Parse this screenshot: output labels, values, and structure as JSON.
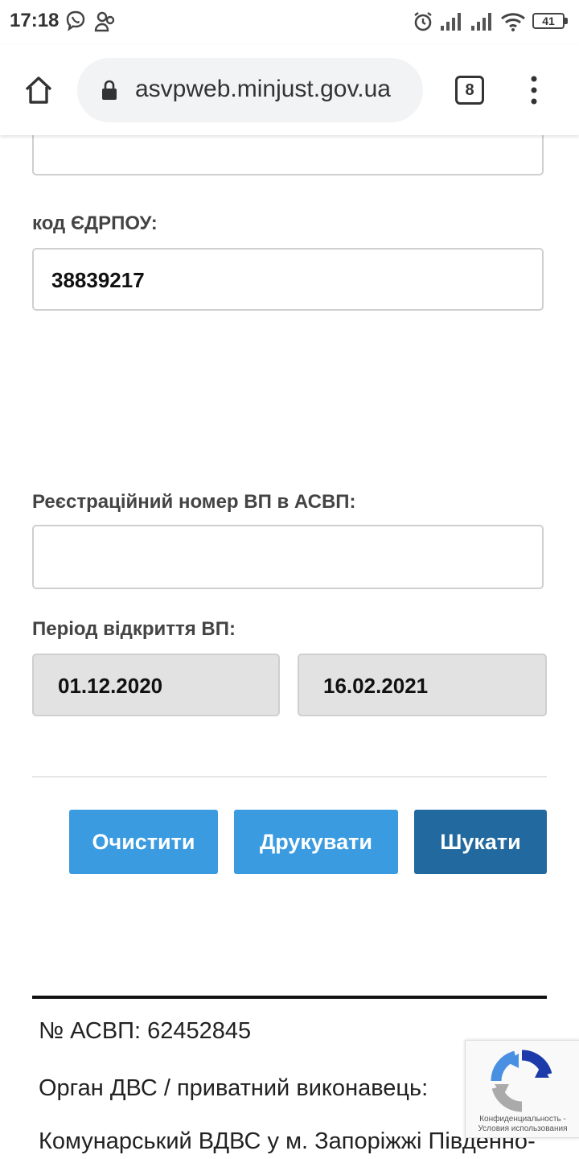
{
  "status_bar": {
    "time": "17:18",
    "battery": "41",
    "icons": [
      "viber-icon",
      "people-icon",
      "alarm-icon",
      "signal-icon",
      "signal-icon",
      "wifi-icon",
      "battery-icon"
    ]
  },
  "browser": {
    "url": "asvpweb.minjust.gov.ua",
    "tab_count": "8",
    "icons": [
      "home-icon",
      "lock-icon",
      "more-menu-icon"
    ]
  },
  "form": {
    "edrpou_label": "код ЄДРПОУ:",
    "edrpou_value": "38839217",
    "reg_number_label": "Реєстраційний номер ВП в АСВП:",
    "reg_number_value": "",
    "period_label": "Період відкриття ВП:",
    "date_from": "01.12.2020",
    "date_to": "16.02.2021"
  },
  "buttons": {
    "clear": "Очистити",
    "print": "Друкувати",
    "search": "Шукати"
  },
  "result": {
    "asvp_number_line": "№ АСВП: 62452845",
    "organ_label": "Орган ДВС / приватний виконавець:",
    "organ_value": "Комунарський ВДВС у м. Запоріжжі Південно-"
  },
  "recaptcha": {
    "caption_line1": "Конфиденциальность -",
    "caption_line2": "Условия использования"
  }
}
